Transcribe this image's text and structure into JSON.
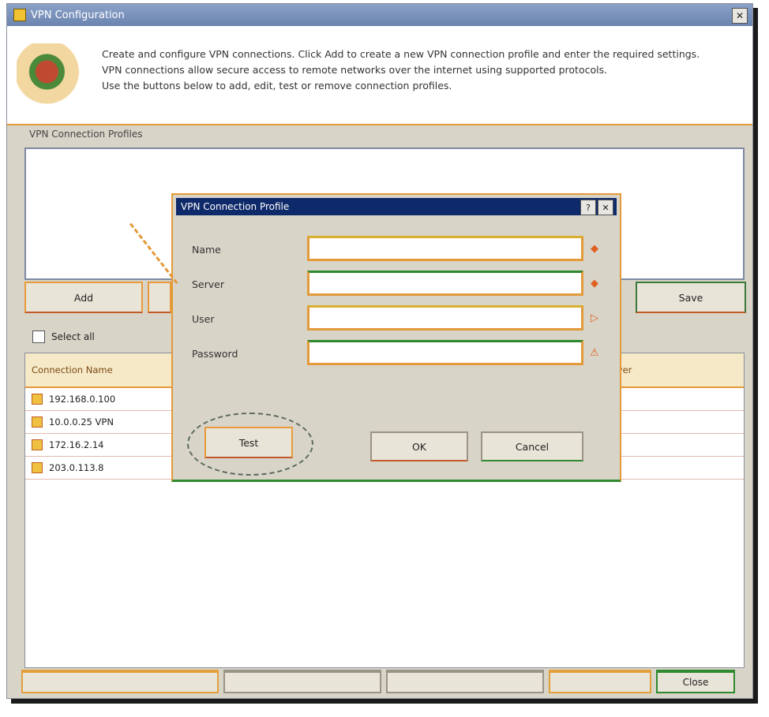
{
  "window": {
    "title": "VPN Configuration",
    "close_glyph": "✕"
  },
  "banner": {
    "lines": [
      "Create and configure VPN connections. Click Add to create a new VPN connection profile and enter the required settings.",
      "VPN connections allow secure access to remote networks over the internet using supported protocols.",
      "Use the buttons below to add, edit, test or remove connection profiles."
    ]
  },
  "profiles_section": {
    "label": "VPN Connection Profiles"
  },
  "buttons": {
    "add": "Add",
    "save": "Save"
  },
  "checkbox": {
    "label": "Select all"
  },
  "table": {
    "header": [
      "Connection Name",
      "Server"
    ],
    "rows": [
      "192.168.0.100",
      "10.0.0.25 VPN",
      "172.16.2.14",
      "203.0.113.8"
    ]
  },
  "dialog": {
    "title": "VPN Connection Profile",
    "fields": [
      {
        "label": "Name",
        "value": ""
      },
      {
        "label": "Server",
        "value": ""
      },
      {
        "label": "User",
        "value": ""
      },
      {
        "label": "Password",
        "value": ""
      }
    ],
    "test_label": "Test",
    "ok_label": "OK",
    "cancel_label": "Cancel"
  },
  "bottom": {
    "labels": [
      "",
      "",
      "",
      "",
      "Close"
    ]
  },
  "colors": {
    "accent_orange": "#e39a3a",
    "accent_green": "#2f8a2f",
    "title_blue": "#0f2a6a"
  }
}
